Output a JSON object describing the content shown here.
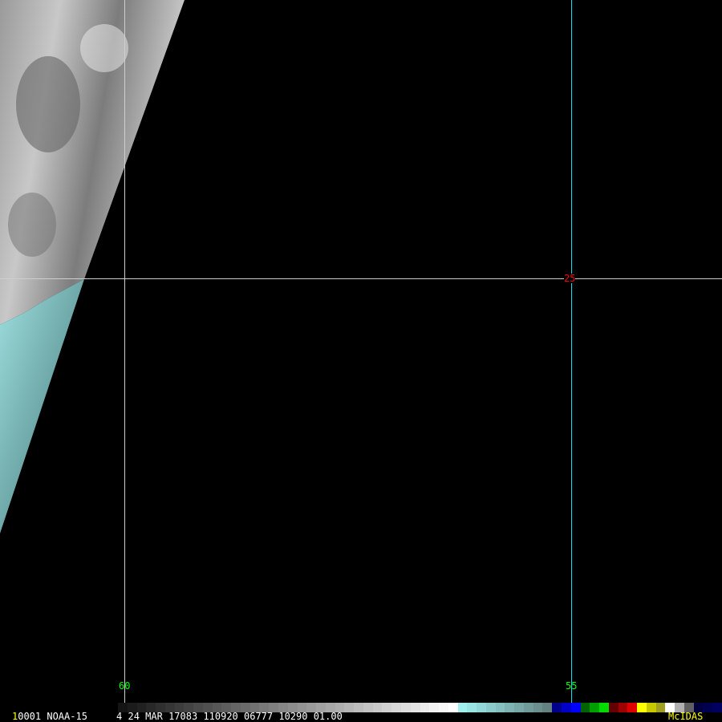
{
  "image": {
    "frame_number": "1",
    "satellite_info": "0001 NOAA-15     4 24 MAR 17083 110920 06777 10290 01.00",
    "brand": "McIDAS"
  },
  "grid": {
    "lon_labels": [
      "60",
      "55"
    ],
    "lat_labels": [
      "25"
    ]
  },
  "colors": {
    "lon_label": "#00ff00",
    "lat_label": "#ff0000",
    "brand": "#ffff00",
    "meridian_55": "#00e5ff",
    "grid_line": "#c8d0d0"
  }
}
